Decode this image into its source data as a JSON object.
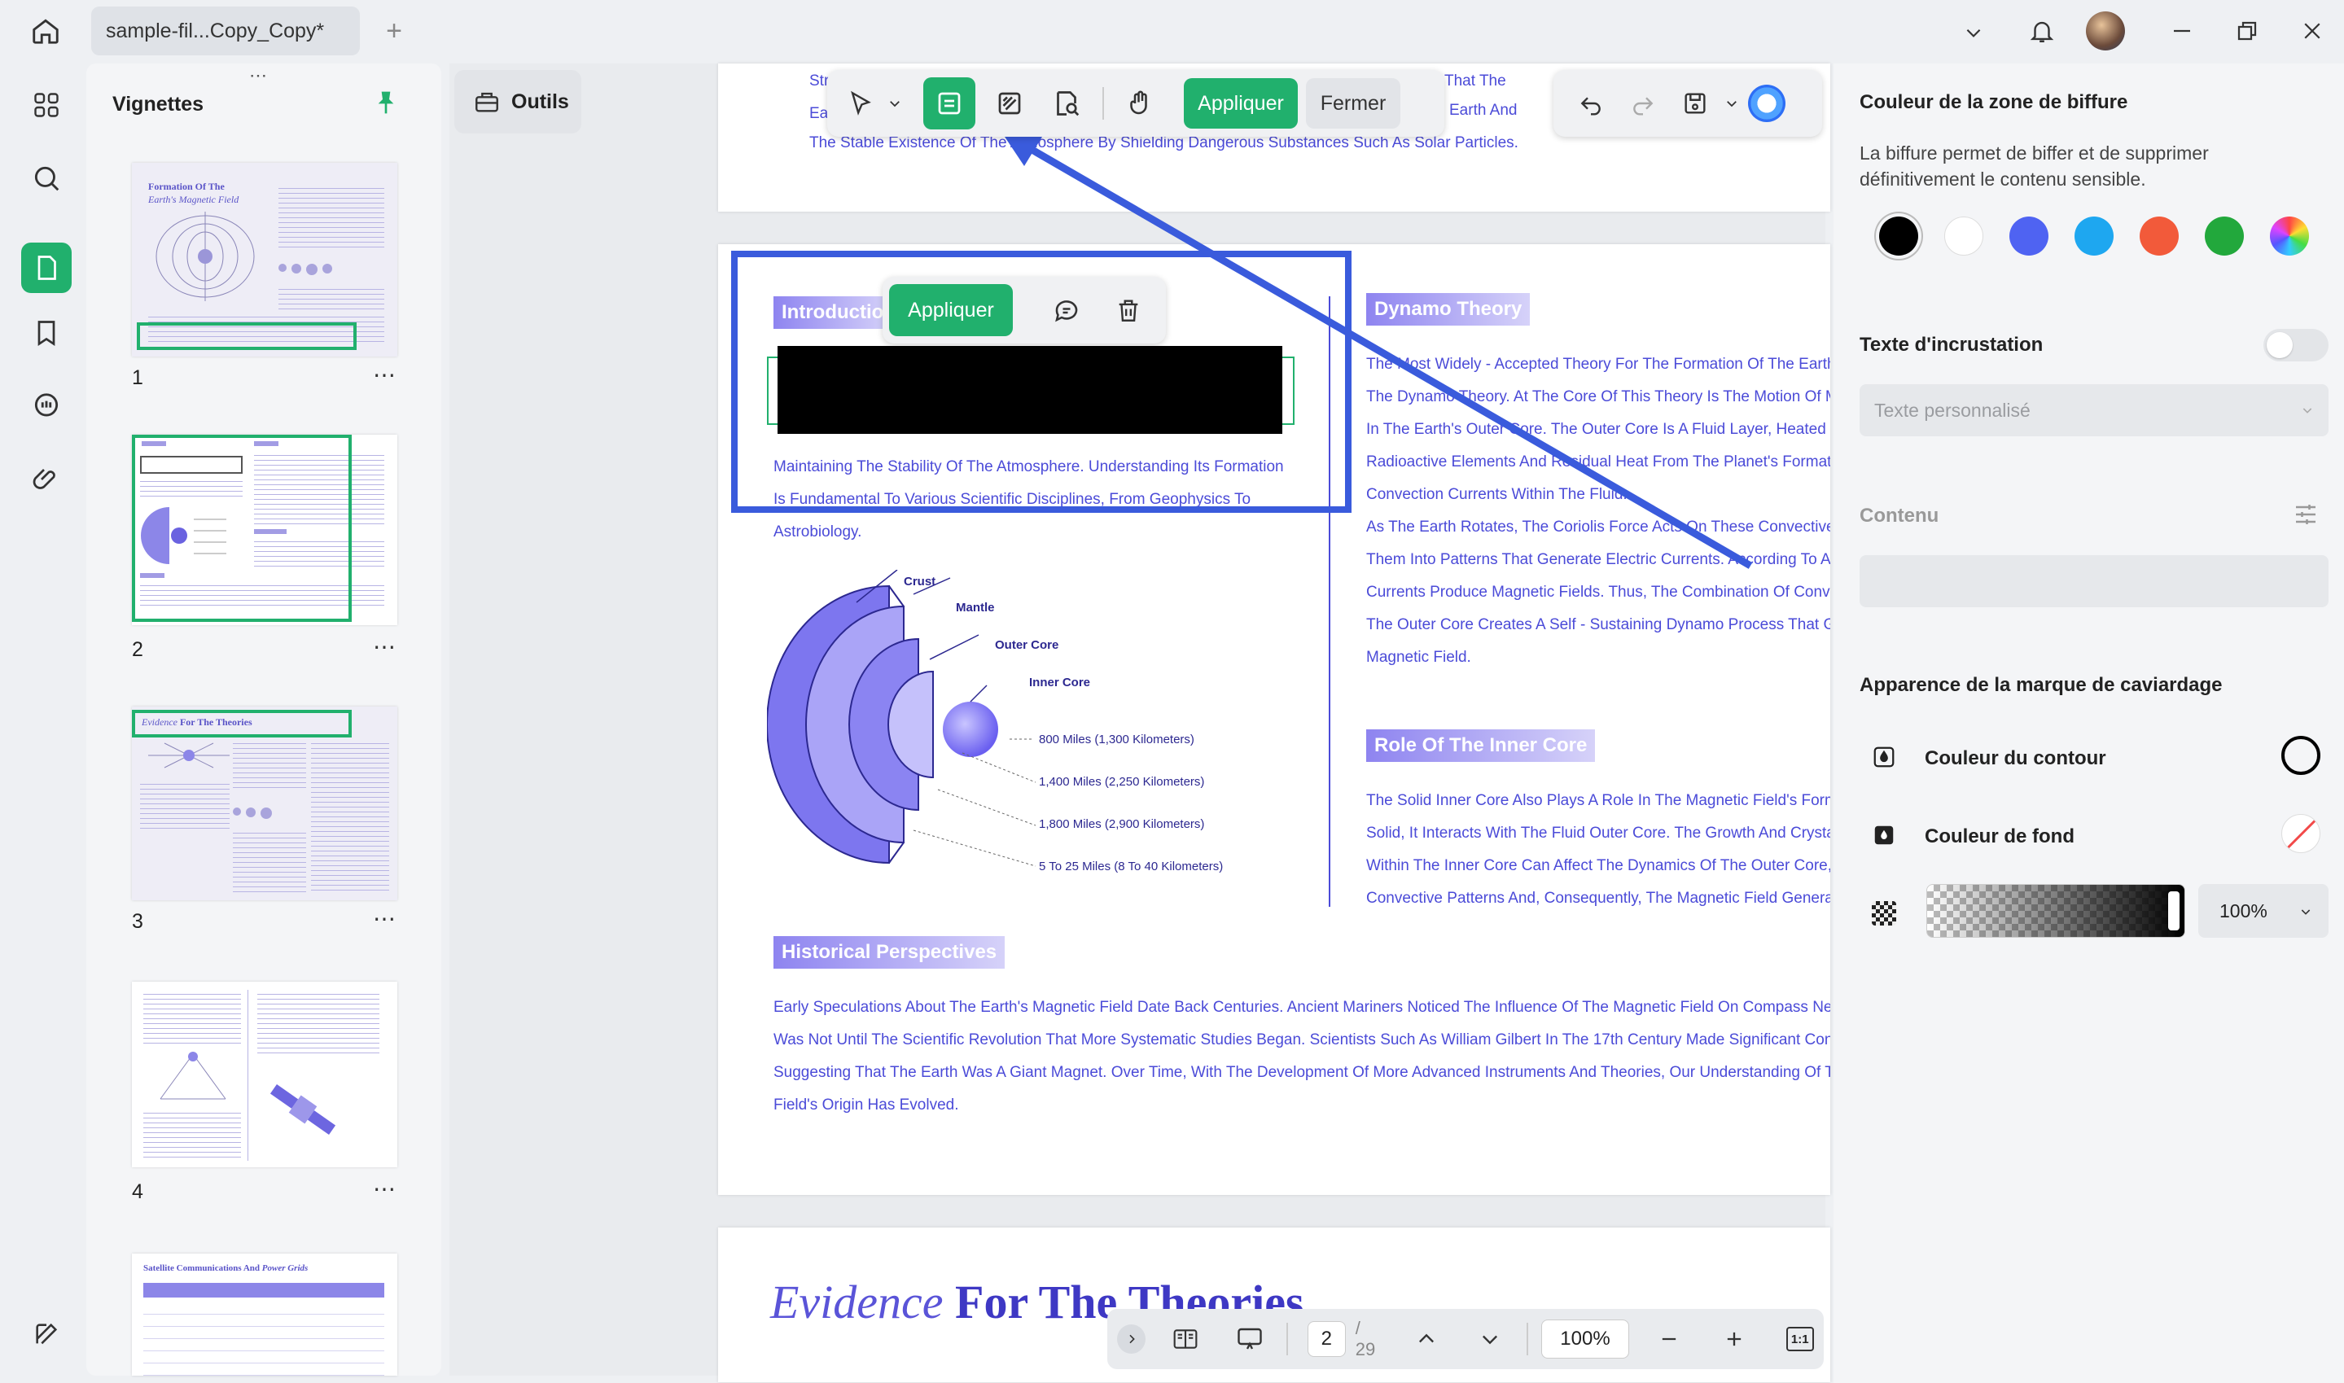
{
  "window": {
    "tab_title": "sample-fil...Copy_Copy*"
  },
  "sidebar_panel": {
    "title": "Vignettes",
    "pages": [
      "1",
      "2",
      "3",
      "4"
    ]
  },
  "tools": {
    "label": "Outils"
  },
  "toolbar": {
    "apply": "Appliquer",
    "close": "Fermer"
  },
  "popup": {
    "apply": "Appliquer"
  },
  "document": {
    "top_lines": [
      "Str",
      "Ea",
      "The Stable Existence Of The Atmosphere By Shielding Dangerous Substances Such As Solar Particles.",
      "That The",
      "Earth And"
    ],
    "intro_heading": "Introductio",
    "intro_lines": [
      "Maintaining The Stability Of The Atmosphere. Understanding Its Formation",
      "Is Fundamental To Various Scientific Disciplines, From Geophysics To",
      "Astrobiology."
    ],
    "diagram_labels": {
      "crust": "Crust",
      "mantle": "Mantle",
      "outer_core": "Outer Core",
      "inner_core": "Inner Core"
    },
    "diagram_measures": [
      "800 Miles (1,300 Kilometers)",
      "1,400 Miles (2,250 Kilometers)",
      "1,800 Miles (2,900 Kilometers)",
      "5 To 25 Miles (8 To 40 Kilometers)"
    ],
    "dynamo_heading": "Dynamo Theory",
    "dynamo_lines": [
      "The Most Widely - Accepted Theory For The Formation Of The Earth",
      "The Dynamo Theory. At The Core Of This Theory Is The Motion Of M",
      "In The Earth's Outer Core. The Outer Core Is A Fluid Layer, Heated E",
      "Radioactive Elements And Residual Heat From The Planet's Formati",
      "Convection Currents Within The Fluid.",
      "As The Earth Rotates, The Coriolis Force Acts On These Convective",
      "Them Into Patterns That Generate Electric Currents. According To Ar",
      "Currents Produce Magnetic Fields. Thus, The Combination Of Conve",
      "The Outer Core Creates A Self - Sustaining Dynamo Process That G",
      "Magnetic Field."
    ],
    "inner_heading": "Role Of The Inner Core",
    "inner_lines": [
      "The Solid Inner Core Also Plays A Role In The Magnetic Field's Form",
      "Solid, It Interacts With The Fluid Outer Core. The Growth And Crysta",
      "Within The Inner Core Can Affect The Dynamics Of The Outer Core,",
      "Convective Patterns And, Consequently, The Magnetic Field Generat"
    ],
    "hist_heading": "Historical Perspectives",
    "hist_lines": [
      "Early Speculations About The Earth's Magnetic Field Date Back Centuries. Ancient Mariners Noticed The Influence Of The Magnetic Field On Compass Need",
      "Was Not Until The Scientific Revolution That More Systematic Studies Began. Scientists Such As William Gilbert In The 17th Century Made Significant Contri",
      "Suggesting That The Earth Was A Giant Magnet. Over Time, With The Development Of More Advanced Instruments And Theories, Our Understanding Of Th",
      "Field's Origin Has Evolved."
    ],
    "next_title_italic": "Evidence",
    "next_title_bold": "For The Theories"
  },
  "right_panel": {
    "title": "Couleur de la zone de biffure",
    "description": "La biffure permet de biffer et de supprimer définitivement le contenu sensible.",
    "swatches": [
      "#000000",
      "#ffffff",
      "#4f63f2",
      "#1ea7f0",
      "#f25a3a",
      "#22a83c",
      "rainbow"
    ],
    "overlay_label": "Texte d'incrustation",
    "overlay_placeholder": "Texte personnalisé",
    "content_label": "Contenu",
    "appearance_label": "Apparence de la marque de caviardage",
    "outline_label": "Couleur du contour",
    "fill_label": "Couleur de fond",
    "opacity": "100%"
  },
  "bottom": {
    "page": "2",
    "total": "/ 29",
    "zoom": "100%"
  },
  "colors": {
    "accent": "#21b06d",
    "doc_text": "#4b4bd8",
    "annotation": "#3a5bdc"
  }
}
